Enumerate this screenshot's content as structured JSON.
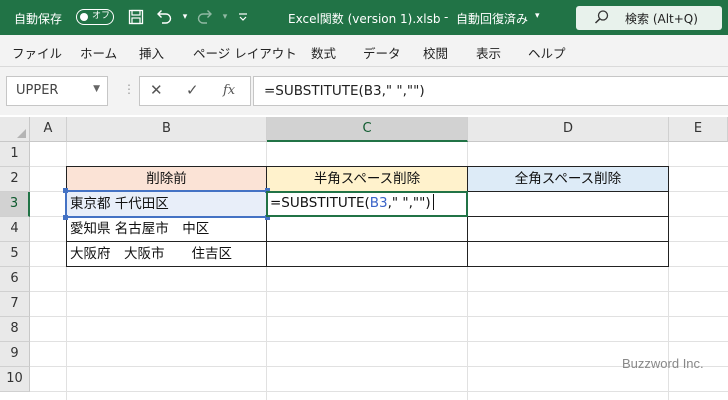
{
  "titlebar": {
    "autosave_label": "自動保存",
    "autosave_state": "オフ",
    "doc_title": "Excel関数 (version 1).xlsb",
    "doc_status": "自動回復済み",
    "search_placeholder": "検索 (Alt+Q)"
  },
  "menu": [
    "ファイル",
    "ホーム",
    "挿入",
    "ページ レイアウト",
    "数式",
    "データ",
    "校閲",
    "表示",
    "ヘルプ"
  ],
  "formula_bar": {
    "name_box": "UPPER",
    "formula": "=SUBSTITUTE(B3,\" \",\"\")"
  },
  "grid": {
    "columns": [
      "A",
      "B",
      "C",
      "D",
      "E"
    ],
    "rows": [
      "1",
      "2",
      "3",
      "4",
      "5",
      "6",
      "7",
      "8",
      "9",
      "10"
    ],
    "headers": {
      "b2": "削除前",
      "c2": "半角スペース削除",
      "d2": "全角スペース削除"
    },
    "cells": {
      "b3": "東京都 千代田区",
      "b4": "愛知県 名古屋市　中区",
      "b5": "大阪府　大阪市　　住吉区"
    },
    "editing": {
      "prefix": "=SUBSTITUTE(",
      "ref": "B3",
      "suffix": ",\" \",\"\")"
    },
    "header_colors": {
      "b2": "#fbe3d6",
      "c2": "#fff2cc",
      "d2": "#ddebf7"
    }
  },
  "watermark": "Buzzword Inc."
}
